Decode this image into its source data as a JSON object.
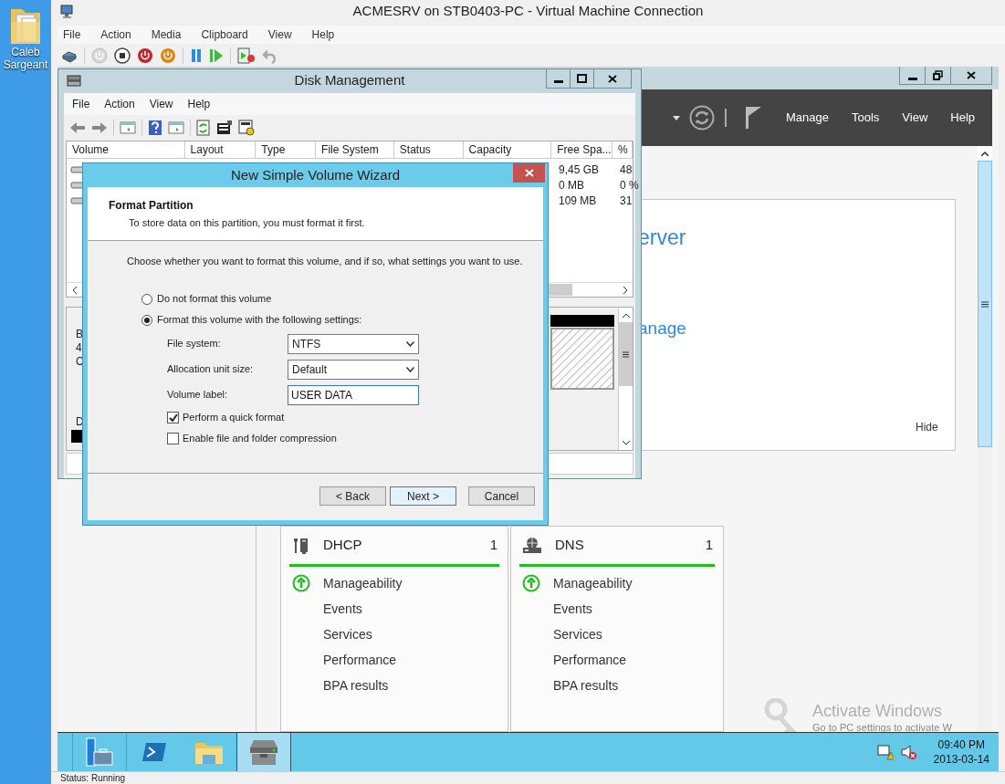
{
  "desktop_icons": [
    {
      "label": "Caleb Sargeant"
    }
  ],
  "vm_window": {
    "title": "ACMESRV on STB0403-PC - Virtual Machine Connection",
    "menu": [
      "File",
      "Action",
      "Media",
      "Clipboard",
      "View",
      "Help"
    ],
    "status": "Status: Running"
  },
  "server_manager": {
    "menu": [
      "Manage",
      "Tools",
      "View",
      "Help"
    ],
    "welcome": {
      "heading_fragment": "erver",
      "link_fragment": "anage",
      "hide": "Hide"
    },
    "tiles": [
      {
        "kind": "dhcp",
        "title": "DHCP",
        "count": "1",
        "items": [
          {
            "label": "Manageability",
            "healthy": true
          },
          {
            "label": "Events",
            "healthy": false
          },
          {
            "label": "Services",
            "healthy": false
          },
          {
            "label": "Performance",
            "healthy": false
          },
          {
            "label": "BPA results",
            "healthy": false
          }
        ]
      },
      {
        "kind": "dns",
        "title": "DNS",
        "count": "1",
        "items": [
          {
            "label": "Manageability",
            "healthy": true
          },
          {
            "label": "Events",
            "healthy": false
          },
          {
            "label": "Services",
            "healthy": false
          },
          {
            "label": "Performance",
            "healthy": false
          },
          {
            "label": "BPA results",
            "healthy": false
          }
        ]
      }
    ]
  },
  "activation_notice": {
    "title": "Activate Windows",
    "text": "Go to PC settings to activate W"
  },
  "taskbar": {
    "apps": [
      {
        "kind": "server-manager",
        "selected": false
      },
      {
        "kind": "powershell",
        "selected": false
      },
      {
        "kind": "explorer",
        "selected": false
      },
      {
        "kind": "disk-management",
        "selected": true
      }
    ],
    "clock": {
      "time": "09:40 PM",
      "date": "2013-03-14"
    }
  },
  "disk_management": {
    "title": "Disk Management",
    "menu": [
      "File",
      "Action",
      "View",
      "Help"
    ],
    "table": {
      "columns": [
        "Volume",
        "Layout",
        "Type",
        "File System",
        "Status",
        "Capacity",
        "Free Spa...",
        "%"
      ],
      "rows": [
        {
          "free_space": "9,45 GB",
          "percent_free": "48"
        },
        {
          "free_space": "0 MB",
          "percent_free": "0 %"
        },
        {
          "free_space": "109 MB",
          "percent_free": "31"
        }
      ]
    },
    "lower_pane_labels": [
      "B",
      "4",
      "C",
      "D"
    ]
  },
  "wizard": {
    "title": "New Simple Volume Wizard",
    "heading": "Format Partition",
    "subheading": "To store data on this partition, you must format it first.",
    "prompt": "Choose whether you want to format this volume, and if so, what settings you want to use.",
    "options": [
      {
        "label": "Do not format this volume",
        "selected": false
      },
      {
        "label": "Format this volume with the following settings:",
        "selected": true
      }
    ],
    "settings": [
      {
        "kind": "dropdown",
        "label": "File system:",
        "value": "NTFS"
      },
      {
        "kind": "dropdown",
        "label": "Allocation unit size:",
        "value": "Default"
      },
      {
        "kind": "text",
        "label": "Volume label:",
        "value": "USER DATA"
      }
    ],
    "checkboxes": [
      {
        "label": "Perform a quick format",
        "checked": true
      },
      {
        "label": "Enable file and folder compression",
        "checked": false
      }
    ],
    "buttons": [
      {
        "label": "< Back",
        "default": false
      },
      {
        "label": "Next >",
        "default": true
      },
      {
        "label": "Cancel",
        "default": false
      }
    ]
  }
}
